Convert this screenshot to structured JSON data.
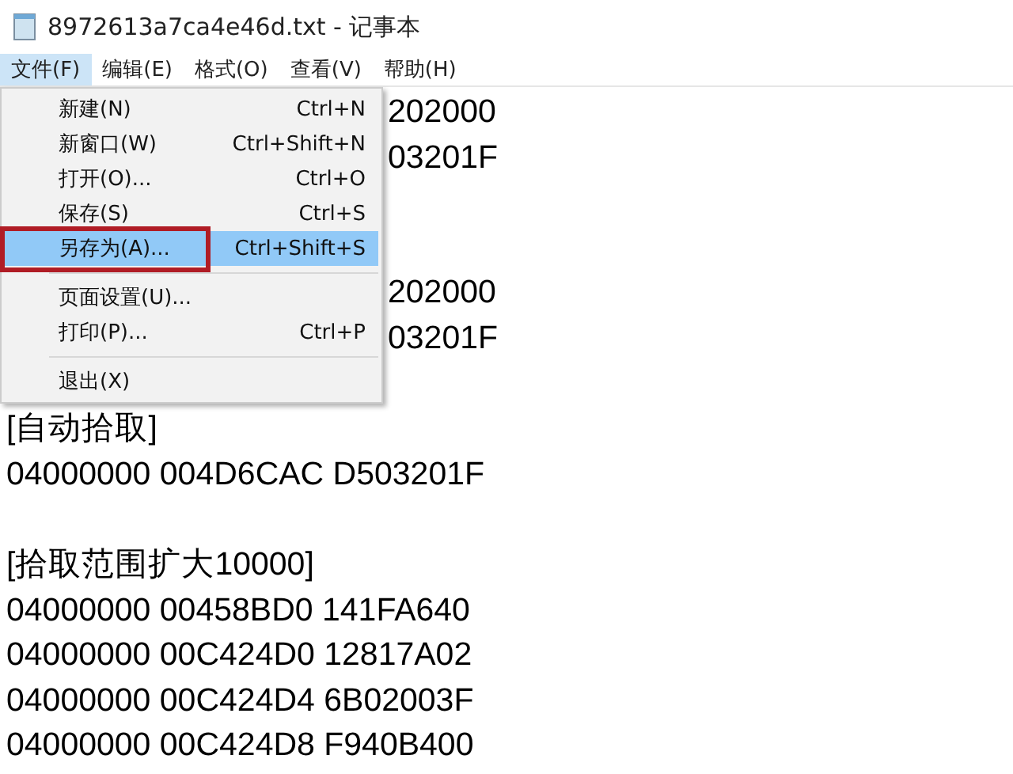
{
  "window": {
    "title": "8972613a7ca4e46d.txt - 记事本"
  },
  "menu_bar": [
    {
      "label": "文件(F)",
      "selected": true
    },
    {
      "label": "编辑(E)",
      "selected": false
    },
    {
      "label": "格式(O)",
      "selected": false
    },
    {
      "label": "查看(V)",
      "selected": false
    },
    {
      "label": "帮助(H)",
      "selected": false
    }
  ],
  "file_menu": [
    {
      "kind": "item",
      "label": "新建(N)",
      "shortcut": "Ctrl+N",
      "selected": false
    },
    {
      "kind": "item",
      "label": "新窗口(W)",
      "shortcut": "Ctrl+Shift+N",
      "selected": false
    },
    {
      "kind": "item",
      "label": "打开(O)...",
      "shortcut": "Ctrl+O",
      "selected": false
    },
    {
      "kind": "item",
      "label": "保存(S)",
      "shortcut": "Ctrl+S",
      "selected": false
    },
    {
      "kind": "item",
      "label": "另存为(A)...",
      "shortcut": "Ctrl+Shift+S",
      "selected": true,
      "outlined": true
    },
    {
      "kind": "separator"
    },
    {
      "kind": "item",
      "label": "页面设置(U)...",
      "selected": false
    },
    {
      "kind": "item",
      "label": "打印(P)...",
      "shortcut": "Ctrl+P",
      "selected": false
    },
    {
      "kind": "separator"
    },
    {
      "kind": "item",
      "label": "退出(X)",
      "selected": false
    }
  ],
  "editor_lines": [
    {
      "kind": "tail",
      "text": "202000"
    },
    {
      "kind": "tail",
      "text": "03201F"
    },
    {
      "kind": "blank"
    },
    {
      "kind": "blank"
    },
    {
      "kind": "tail",
      "text": "202000"
    },
    {
      "kind": "tail",
      "text": "03201F"
    },
    {
      "kind": "blank"
    },
    {
      "kind": "text",
      "text": "[自动拾取]"
    },
    {
      "kind": "text",
      "text": "04000000 004D6CAC D503201F"
    },
    {
      "kind": "blank"
    },
    {
      "kind": "text",
      "text": "[拾取范围扩大10000]"
    },
    {
      "kind": "text",
      "text": "04000000 00458BD0 141FA640"
    },
    {
      "kind": "text",
      "text": "04000000 00C424D0 12817A02"
    },
    {
      "kind": "text",
      "text": "04000000 00C424D4 6B02003F"
    },
    {
      "kind": "text",
      "text": "04000000 00C424D8 F940B400"
    }
  ]
}
